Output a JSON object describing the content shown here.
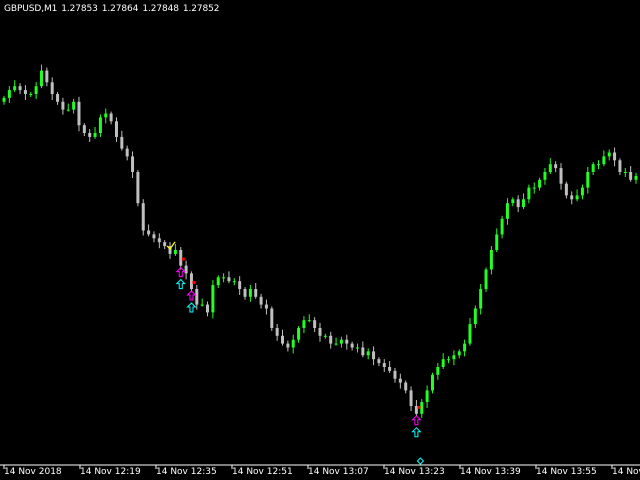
{
  "header": {
    "symbol": "GBPUSD,M1",
    "open": "1.27853",
    "high": "1.27864",
    "low": "1.27848",
    "close": "1.27852"
  },
  "colors": {
    "background": "#000000",
    "bull": "#22ff22",
    "bear": "#c0c0c0",
    "axis": "#ffffff",
    "signal_up": "#ff00ff",
    "signal_arrow": "#00ffff",
    "signal_dot": "#ff0000",
    "check": "#ffff00"
  },
  "chart_data": {
    "type": "candlestick",
    "timeframe": "M1",
    "x_tick_labels": [
      "14 Nov 2018",
      "14 Nov 12:19",
      "14 Nov 12:35",
      "14 Nov 12:51",
      "14 Nov 13:07",
      "14 Nov 13:23",
      "14 Nov 13:39",
      "14 Nov 13:55",
      "14 Nov"
    ],
    "y_domain": [
      0,
      100
    ],
    "closes": [
      89,
      91,
      92,
      91,
      90,
      90,
      92,
      96,
      93,
      90,
      88,
      86,
      86,
      88,
      82,
      80,
      79,
      80,
      84,
      85,
      83,
      79,
      76,
      74,
      70,
      62,
      55,
      54,
      53,
      52,
      51,
      49,
      50,
      46,
      44,
      40,
      36,
      36,
      34,
      41,
      43,
      43,
      42,
      42,
      40,
      38,
      40,
      38,
      36,
      35,
      30,
      28,
      26,
      25,
      27,
      30,
      32,
      32,
      30,
      28,
      28,
      26,
      26,
      27,
      26,
      25,
      25,
      23,
      24,
      22,
      21,
      20,
      19,
      17,
      16,
      14,
      10,
      8,
      11,
      14,
      18,
      20,
      22,
      22,
      23,
      24,
      26,
      31,
      35,
      40,
      45,
      50,
      54,
      58,
      62,
      63,
      61,
      63,
      66,
      66,
      68,
      70,
      72,
      71,
      67,
      64,
      63,
      64,
      66,
      70,
      72,
      72,
      74,
      75,
      73,
      70,
      70,
      68,
      69
    ],
    "signals": [
      {
        "index": 31,
        "kind": "check"
      },
      {
        "index": 33,
        "kind": "up_arrow_pair"
      },
      {
        "index": 35,
        "kind": "up_arrow_pair"
      },
      {
        "index": 77,
        "kind": "up_arrow_pair"
      }
    ]
  }
}
